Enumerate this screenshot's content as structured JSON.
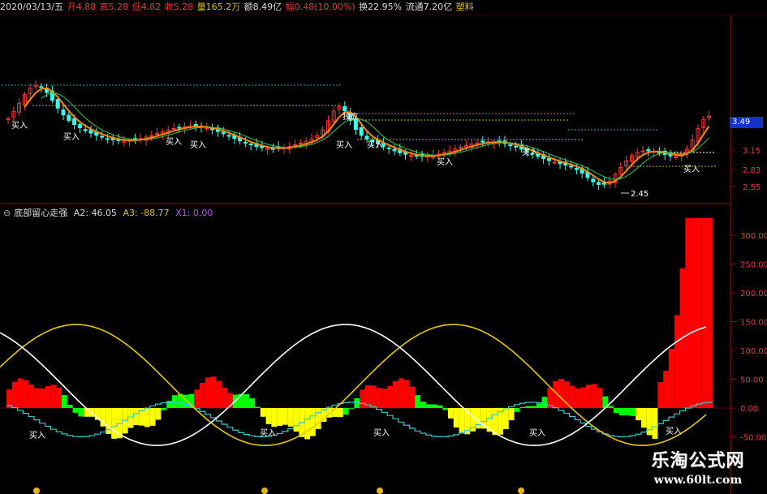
{
  "infobar": {
    "date": "2020/03/13/五",
    "open": "开4.88",
    "high": "高5.28",
    "low": "低4.82",
    "close": "收5.28",
    "volume": "量165.2万",
    "amount": "额8.49亿",
    "change": "幅0.48(10.00%)",
    "turnover": "换22.95%",
    "float": "流通7.20亿",
    "sector": "塑料"
  },
  "colors": {
    "up": "#ff3333",
    "down": "#33ffee",
    "ma": "#ff8800",
    "yellow": "#ffff00",
    "green": "#00ff00",
    "red": "#ff0000",
    "sine_yellow": "#e6c800",
    "sine_white": "#ffffff",
    "axis": "#aa0000"
  },
  "price_panel": {
    "y_ticks": [
      "3.15",
      "2.83",
      "2.55"
    ],
    "current_price": "3.49",
    "low_marker": "2.45",
    "standalone_label": "独立",
    "buy_label": "买入"
  },
  "indicator_panel": {
    "name": "底部留心走强",
    "a2": "A2: 46.05",
    "a3": "A3: -88.77",
    "x1": "X1: 0.00",
    "y_ticks": [
      "300.00",
      "250.00",
      "200.00",
      "150.00",
      "100.00",
      "50.00",
      "0.00",
      "-50.00"
    ],
    "buy_label": "买入"
  },
  "watermark": {
    "title": "乐淘公式网",
    "url": "www.60lt.com"
  }
}
